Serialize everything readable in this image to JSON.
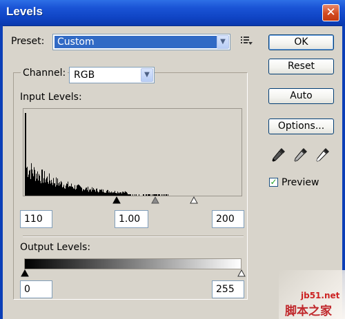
{
  "window": {
    "title": "Levels",
    "close_symbol": "✕"
  },
  "preset": {
    "label": "Preset:",
    "value": "Custom"
  },
  "buttons": {
    "ok": "OK",
    "reset": "Reset",
    "auto": "Auto",
    "options": "Options..."
  },
  "channel": {
    "label": "Channel:",
    "value": "RGB"
  },
  "input_levels": {
    "label": "Input Levels:",
    "black": "110",
    "gamma": "1.00",
    "white": "200"
  },
  "output_levels": {
    "label": "Output Levels:",
    "black": "0",
    "white": "255"
  },
  "preview": {
    "label": "Preview",
    "checked": true
  },
  "eyedroppers": [
    "black-eyedropper-icon",
    "gray-eyedropper-icon",
    "white-eyedropper-icon"
  ],
  "watermark": {
    "site": "jb51.net",
    "brand": "脚本之家"
  },
  "colors": {
    "title_bar": "#1a54d6",
    "dialog_bg": "#d8d4cb",
    "selection": "#316ac5",
    "close_button": "#d34a20"
  }
}
